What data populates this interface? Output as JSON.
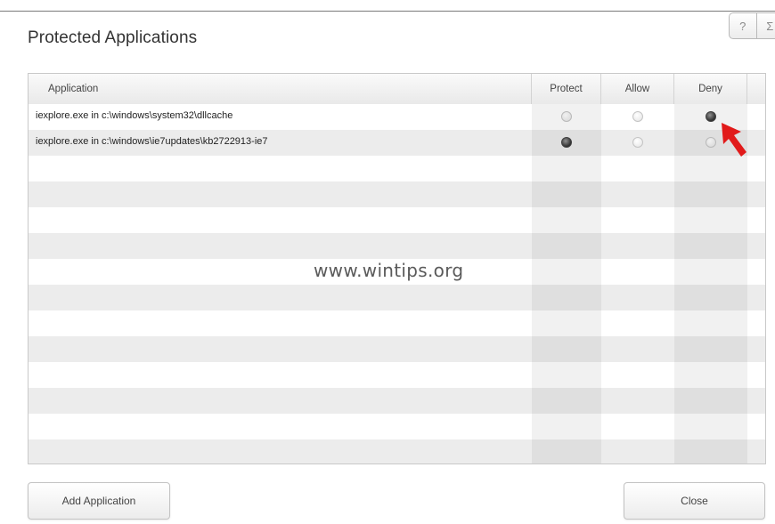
{
  "dialog": {
    "title": "Protected Applications",
    "help_icon": "help-question-icon",
    "close_icon": "close-x-icon",
    "help_glyph": "?",
    "close_glyph": "Σ"
  },
  "table": {
    "columns": {
      "application": "Application",
      "protect": "Protect",
      "allow": "Allow",
      "deny": "Deny"
    },
    "rows": [
      {
        "application": "iexplore.exe in c:\\windows\\system32\\dllcache",
        "selection": "deny"
      },
      {
        "application": "iexplore.exe in c:\\windows\\ie7updates\\kb2722913-ie7",
        "selection": "protect"
      }
    ],
    "empty_row_count": 12
  },
  "watermark": "www.wintips.org",
  "buttons": {
    "add_application": "Add Application",
    "close": "Close"
  },
  "colors": {
    "annotation_arrow": "#e11a1a",
    "selected_radio": "#333333"
  }
}
